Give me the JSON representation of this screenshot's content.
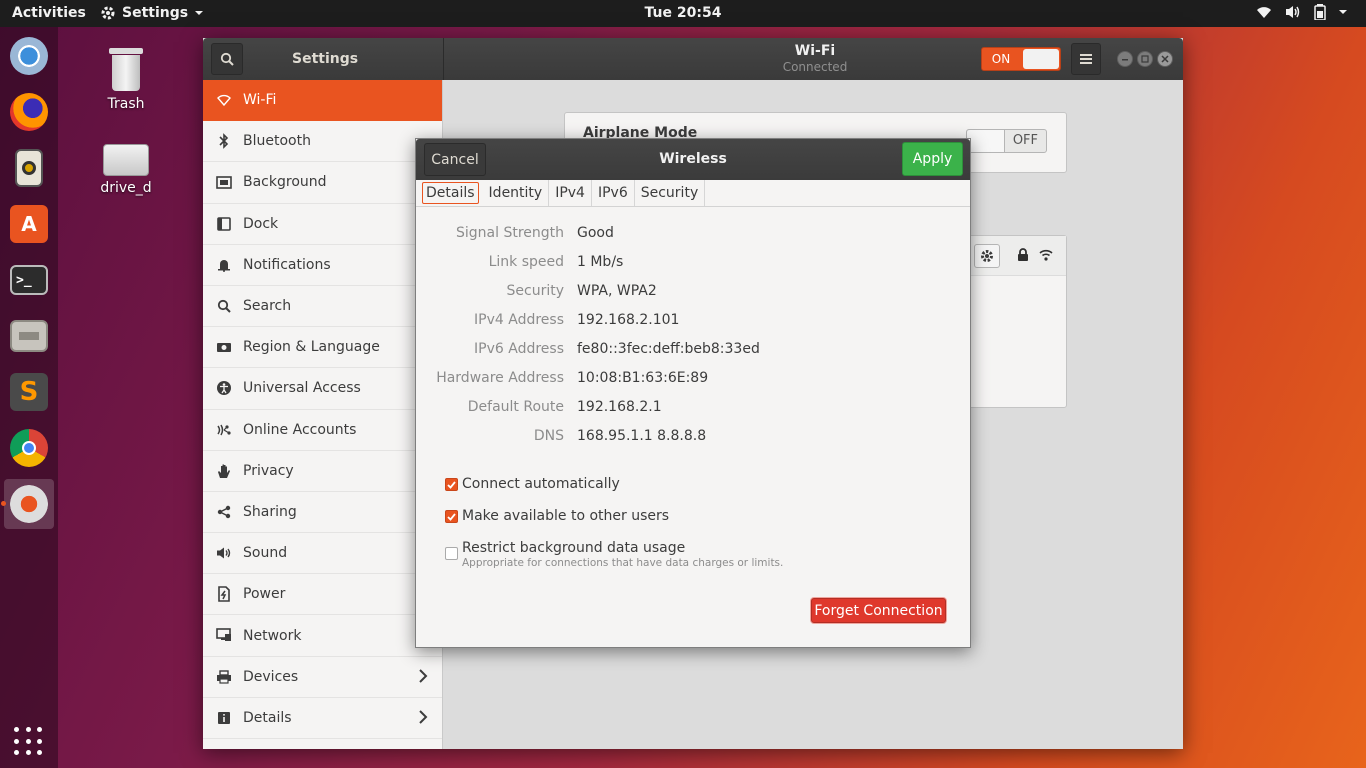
{
  "topbar": {
    "activities": "Activities",
    "app_menu": "Settings",
    "clock": "Tue 20:54"
  },
  "dock": {
    "items": [
      "Chromium",
      "Firefox",
      "Rhythmbox",
      "Ubuntu Software",
      "Terminal",
      "Files",
      "Sublime Text",
      "Chrome",
      "Settings"
    ],
    "show_apps_icon": "grid-icon"
  },
  "desktop": {
    "icons": [
      {
        "label": "Trash"
      },
      {
        "label": "drive_d"
      }
    ]
  },
  "window": {
    "left_title": "Settings",
    "title": "Wi-Fi",
    "subtitle": "Connected",
    "wifi_switch": "ON"
  },
  "sidebar": {
    "items": [
      {
        "label": "Wi-Fi",
        "icon": "wifi-icon"
      },
      {
        "label": "Bluetooth",
        "icon": "bluetooth-icon"
      },
      {
        "label": "Background",
        "icon": "background-icon"
      },
      {
        "label": "Dock",
        "icon": "dock-icon"
      },
      {
        "label": "Notifications",
        "icon": "bell-icon"
      },
      {
        "label": "Search",
        "icon": "search-icon"
      },
      {
        "label": "Region & Language",
        "icon": "camera-icon"
      },
      {
        "label": "Universal Access",
        "icon": "accessibility-icon"
      },
      {
        "label": "Online Accounts",
        "icon": "accounts-icon"
      },
      {
        "label": "Privacy",
        "icon": "hand-icon"
      },
      {
        "label": "Sharing",
        "icon": "share-icon"
      },
      {
        "label": "Sound",
        "icon": "speaker-icon"
      },
      {
        "label": "Power",
        "icon": "power-icon"
      },
      {
        "label": "Network",
        "icon": "network-icon"
      },
      {
        "label": "Devices",
        "icon": "printer-icon"
      },
      {
        "label": "Details",
        "icon": "info-icon"
      }
    ]
  },
  "main": {
    "airplane_mode": "Airplane Mode",
    "airplane_switch": "OFF"
  },
  "dialog": {
    "cancel": "Cancel",
    "title": "Wireless",
    "apply": "Apply",
    "tabs": [
      "Details",
      "Identity",
      "IPv4",
      "IPv6",
      "Security"
    ],
    "details": [
      {
        "key": "Signal Strength",
        "value": "Good"
      },
      {
        "key": "Link speed",
        "value": "1 Mb/s"
      },
      {
        "key": "Security",
        "value": "WPA, WPA2"
      },
      {
        "key": "IPv4 Address",
        "value": "192.168.2.101"
      },
      {
        "key": "IPv6 Address",
        "value": "fe80::3fec:deff:beb8:33ed"
      },
      {
        "key": "Hardware Address",
        "value": "10:08:B1:63:6E:89"
      },
      {
        "key": "Default Route",
        "value": "192.168.2.1"
      },
      {
        "key": "DNS",
        "value": "168.95.1.1 8.8.8.8"
      }
    ],
    "checks": [
      {
        "label": "Connect automatically",
        "checked": true
      },
      {
        "label": "Make available to other users",
        "checked": true
      },
      {
        "label": "Restrict background data usage",
        "hint": "Appropriate for connections that have data charges or limits.",
        "checked": false
      }
    ],
    "forget": "Forget Connection"
  },
  "colors": {
    "accent": "#e95420",
    "apply_green": "#3bb24a",
    "destructive": "#df382c"
  }
}
